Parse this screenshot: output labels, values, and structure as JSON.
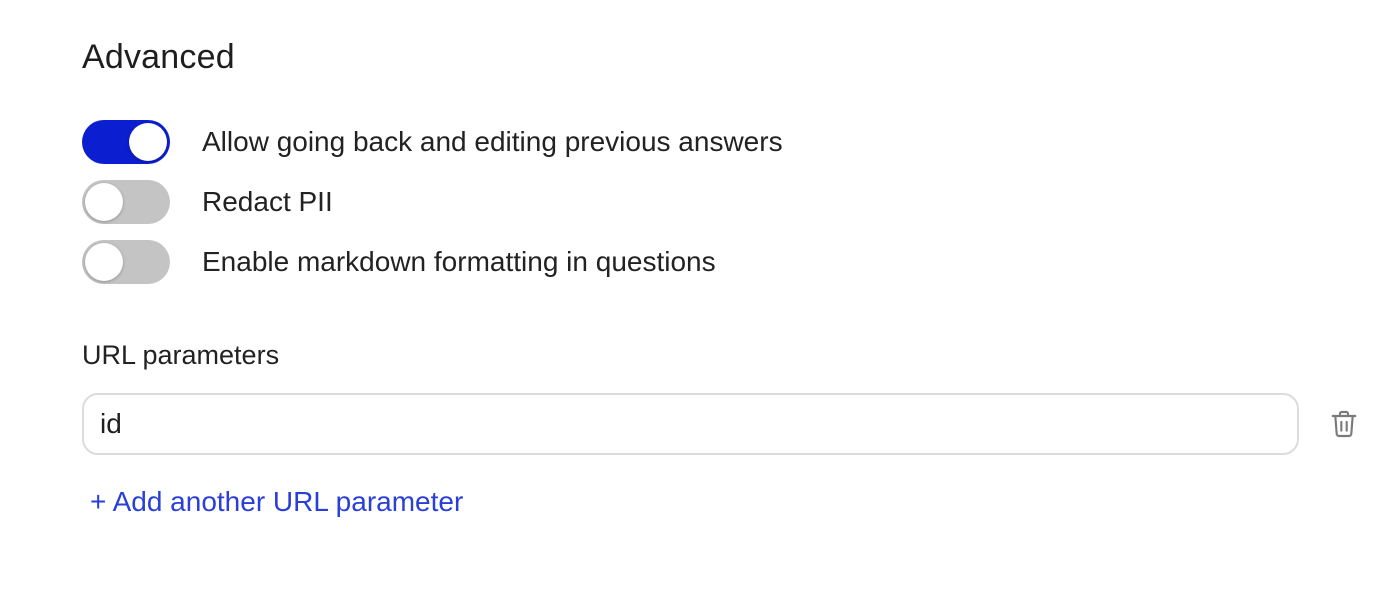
{
  "section": {
    "title": "Advanced"
  },
  "toggles": [
    {
      "label": "Allow going back and editing previous answers",
      "on": true
    },
    {
      "label": "Redact PII",
      "on": false
    },
    {
      "label": "Enable markdown formatting in questions",
      "on": false
    }
  ],
  "url_parameters": {
    "label": "URL parameters",
    "items": [
      {
        "value": "id"
      }
    ],
    "delete_icon": "trash-icon",
    "add_label": "+ Add another URL parameter"
  },
  "colors": {
    "toggle_on": "#0b1fd0",
    "toggle_off": "#c4c4c4",
    "link": "#2a3fd8"
  }
}
